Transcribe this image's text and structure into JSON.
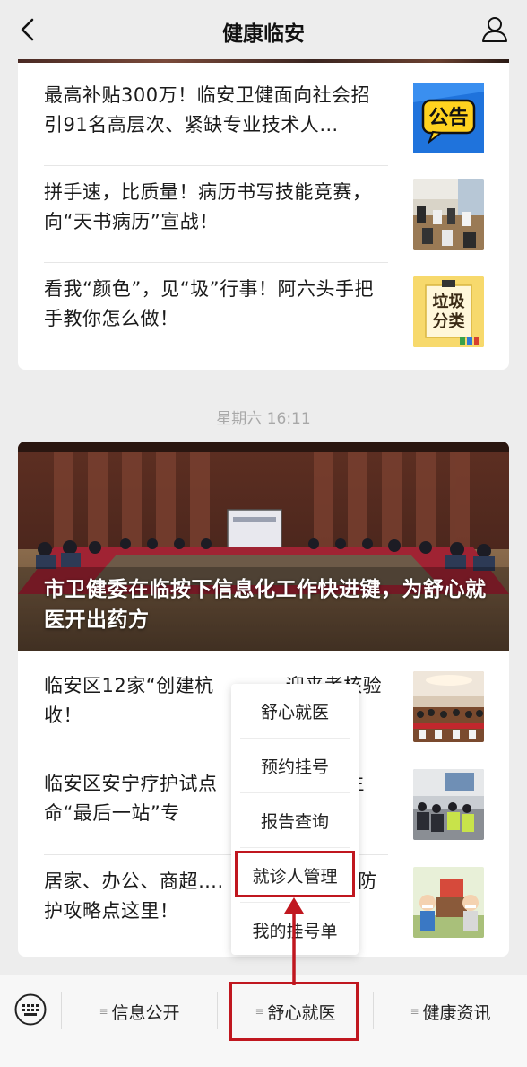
{
  "header": {
    "title": "健康临安"
  },
  "feed1": [
    {
      "title": "最高补贴300万！临安卫健面向社会招引91名高层次、紧缺专业技术人…",
      "thumb_text": "公告"
    },
    {
      "title": "拼手速，比质量！病历书写技能竞赛，向“天书病历”宣战！"
    },
    {
      "title": "看我“颜色”，见“圾”行事！阿六头手把手教你怎么做！",
      "thumb_text_1": "垃圾",
      "thumb_text_2": "分类"
    }
  ],
  "date_label": "星期六 16:11",
  "hero": {
    "caption": "市卫健委在临按下信息化工作快进键，为舒心就医开出药方"
  },
  "feed2": [
    {
      "title_visible": "临安区12家“创建杭",
      "title_tail": "迎来考核验收！"
    },
    {
      "title_visible": "临安区安宁疗护试点",
      "title_tail": "，让生命“最后一站”专"
    },
    {
      "title_visible": "居家、办公、商超….",
      "title_tail": "、防护攻略点这里！"
    }
  ],
  "popup_menu": [
    {
      "label": "舒心就医"
    },
    {
      "label": "预约挂号"
    },
    {
      "label": "报告查询"
    },
    {
      "label": "就诊人管理"
    },
    {
      "label": "我的挂号单"
    }
  ],
  "bottom_tabs": [
    {
      "label": "信息公开"
    },
    {
      "label": "舒心就医"
    },
    {
      "label": "健康资讯"
    }
  ],
  "colors": {
    "highlight": "#c0171f",
    "background": "#ededed"
  }
}
